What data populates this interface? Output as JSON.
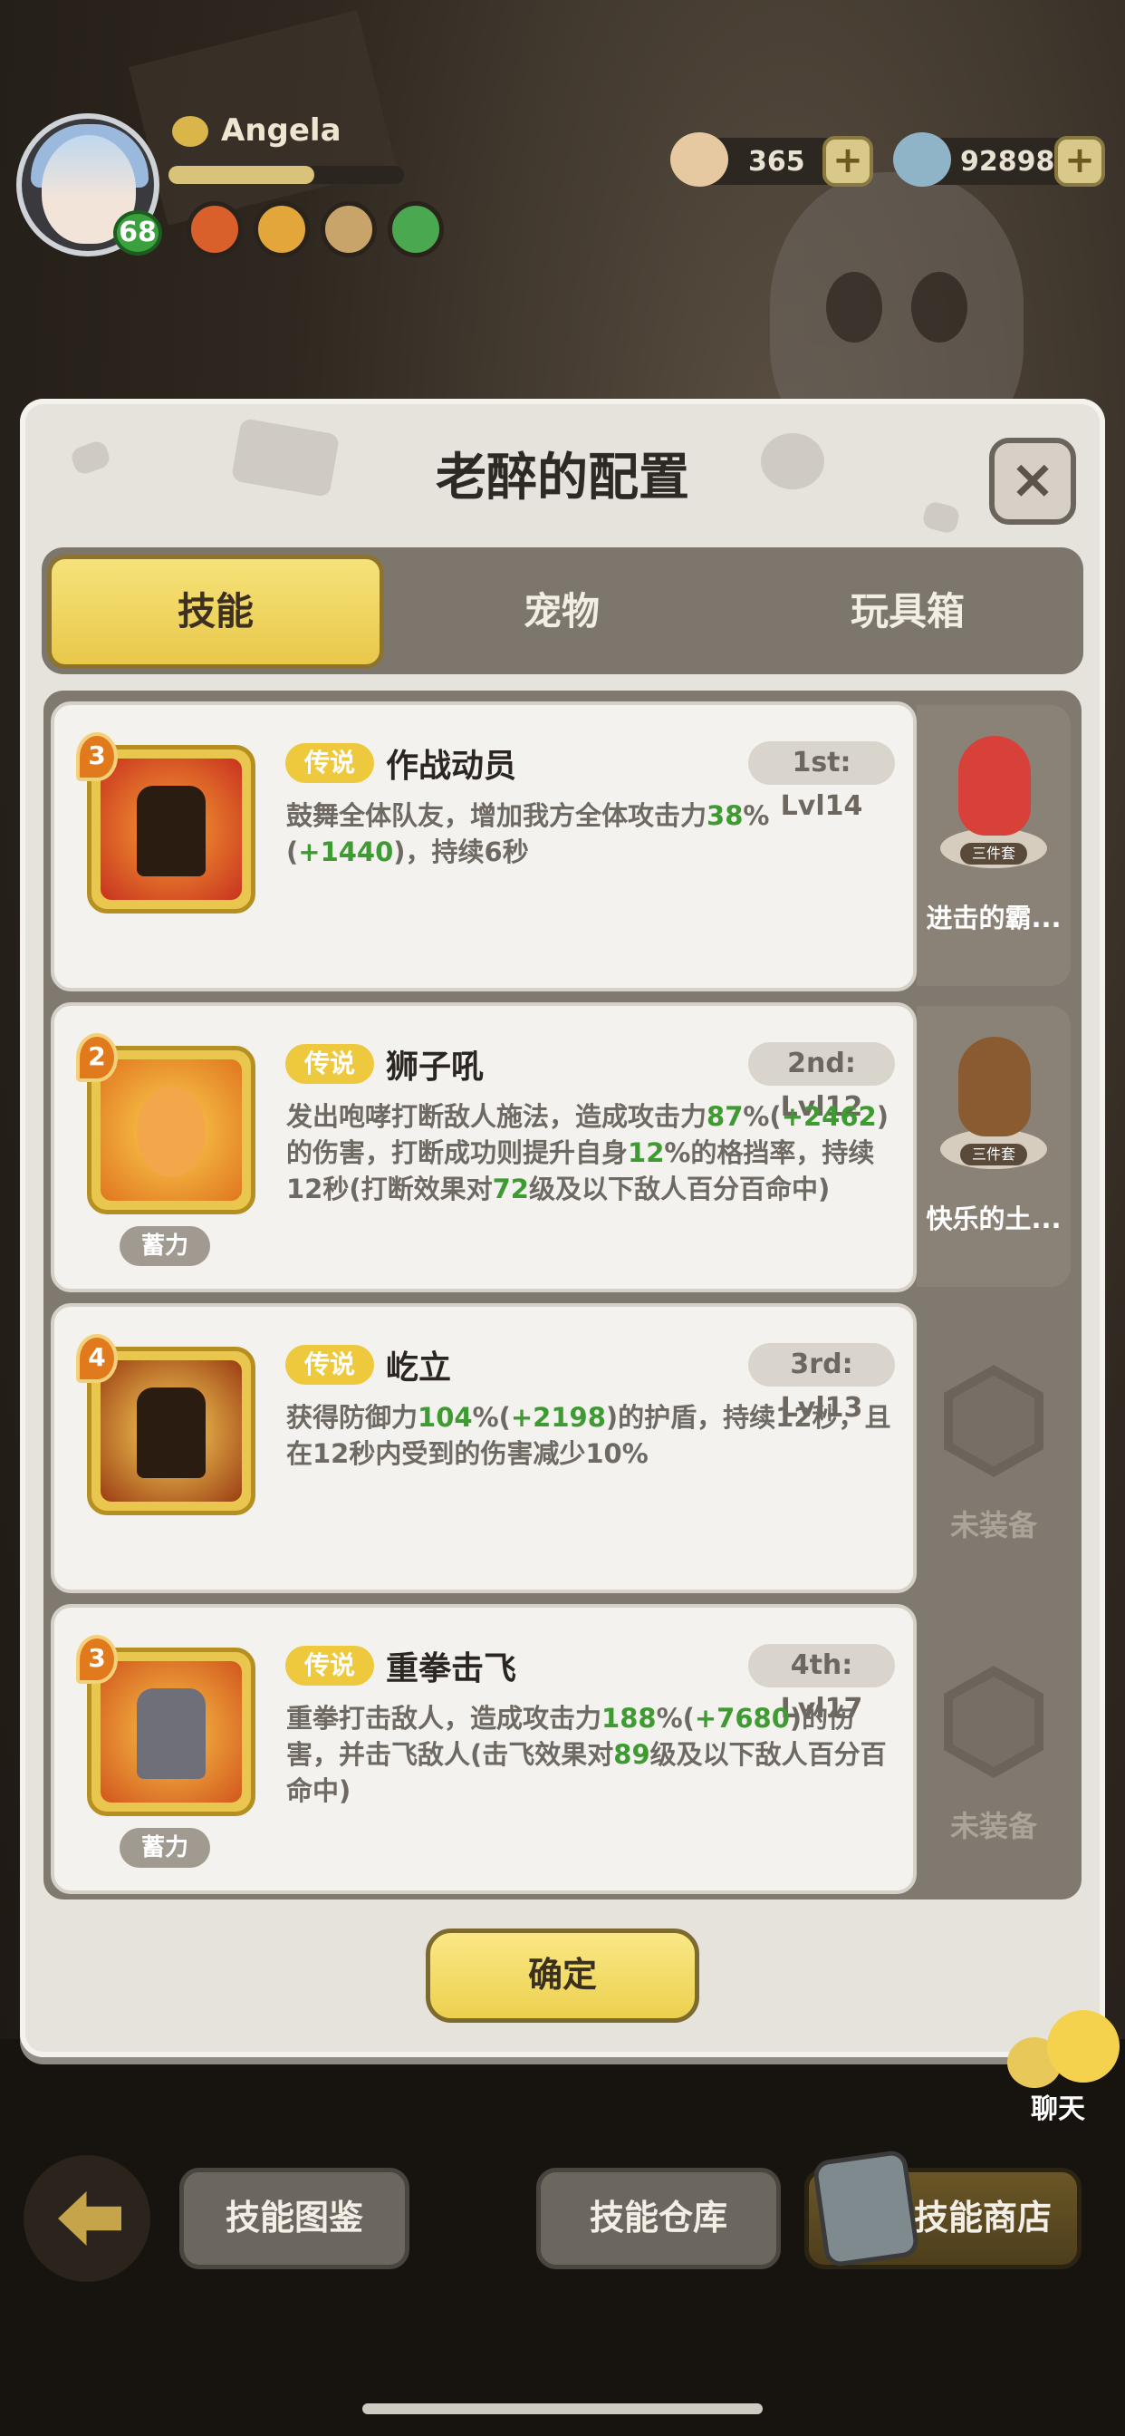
{
  "player": {
    "name": "Angela",
    "level": "68",
    "xp_fraction": 0.62,
    "badges": [
      "flower-badge",
      "coin-badge",
      "compass-badge",
      "heart-shield-badge"
    ]
  },
  "currencies": [
    {
      "icon": "shell-icon",
      "value": "365"
    },
    {
      "icon": "pearl-icon",
      "value": "92898"
    }
  ],
  "dialog": {
    "title": "老醉的配置",
    "tabs": [
      "技能",
      "宠物",
      "玩具箱"
    ],
    "active_tab": "技能",
    "confirm_label": "确定"
  },
  "skills": [
    {
      "rank": "3",
      "rarity": "传说",
      "name": "作战动员",
      "slot_level": "1st: Lvl14",
      "desc": [
        {
          "t": "鼓舞全体队友，增加我方全体攻击力"
        },
        {
          "t": "38",
          "g": true
        },
        {
          "t": "%("
        },
        {
          "t": "+1440",
          "g": true
        },
        {
          "t": ")，持续6秒"
        }
      ],
      "charge": "",
      "side": {
        "type": "pet",
        "set_label": "三件套",
        "name": "进击的霸..."
      }
    },
    {
      "rank": "2",
      "rarity": "传说",
      "name": "狮子吼",
      "slot_level": "2nd: Lvl12",
      "desc": [
        {
          "t": "发出咆哮打断敌人施法，造成攻击力"
        },
        {
          "t": "87",
          "g": true
        },
        {
          "t": "%("
        },
        {
          "t": "+2462",
          "g": true
        },
        {
          "t": ")的伤害，打断成功则提升自身"
        },
        {
          "t": "12",
          "g": true
        },
        {
          "t": "%的格挡率，持续12秒(打断效果对"
        },
        {
          "t": "72",
          "g": true
        },
        {
          "t": "级及以下敌人百分百命中)"
        }
      ],
      "charge": "蓄力",
      "side": {
        "type": "pet",
        "set_label": "三件套",
        "name": "快乐的土..."
      }
    },
    {
      "rank": "4",
      "rarity": "传说",
      "name": "屹立",
      "slot_level": "3rd: Lvl13",
      "desc": [
        {
          "t": "获得防御力"
        },
        {
          "t": "104",
          "g": true
        },
        {
          "t": "%("
        },
        {
          "t": "+2198",
          "g": true
        },
        {
          "t": ")的护盾，持续12秒，且在12秒内受到的伤害减少10%"
        }
      ],
      "charge": "",
      "side": {
        "type": "empty",
        "label": "未装备"
      }
    },
    {
      "rank": "3",
      "rarity": "传说",
      "name": "重拳击飞",
      "slot_level": "4th: Lvl17",
      "desc": [
        {
          "t": "重拳打击敌人，造成攻击力"
        },
        {
          "t": "188",
          "g": true
        },
        {
          "t": "%("
        },
        {
          "t": "+7680",
          "g": true
        },
        {
          "t": ")的伤害，并击飞敌人(击飞效果对"
        },
        {
          "t": "89",
          "g": true
        },
        {
          "t": "级及以下敌人百分百命中)"
        }
      ],
      "charge": "蓄力",
      "side": {
        "type": "empty",
        "label": "未装备"
      }
    }
  ],
  "chat_label": "聊天",
  "bottom_bar": {
    "catalog": "技能图鉴",
    "warehouse": "技能仓库",
    "shop": "技能商店"
  },
  "colors": {
    "accent_yellow": "#efc93d",
    "value_green": "#3d9b32",
    "panel_bg": "#e6e3dd"
  }
}
